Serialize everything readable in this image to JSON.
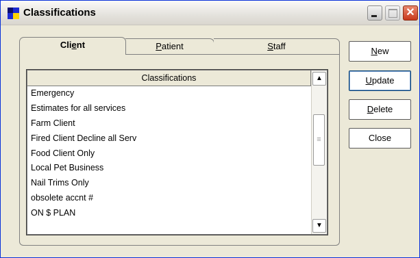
{
  "window": {
    "title": "Classifications"
  },
  "tabs": [
    {
      "label": "Client",
      "mnemonic_index": 3,
      "selected": true
    },
    {
      "label": "Patient",
      "mnemonic_index": 0,
      "selected": false
    },
    {
      "label": "Staff",
      "mnemonic_index": 0,
      "selected": false
    }
  ],
  "list": {
    "header": "Classifications",
    "items": [
      "Emergency",
      "Estimates for all services",
      "Farm Client",
      "Fired Client Decline all Serv",
      "Food Client Only",
      "Local Pet Business",
      "Nail Trims Only",
      "obsolete accnt #",
      "ON $ PLAN"
    ]
  },
  "buttons": {
    "new": {
      "label": "New",
      "mnemonic_index": 0
    },
    "update": {
      "label": "Update",
      "mnemonic_index": 0
    },
    "delete": {
      "label": "Delete",
      "mnemonic_index": 0
    },
    "close": {
      "label": "Close",
      "mnemonic_index": -1
    }
  },
  "icons": {
    "app": "classifications-app-icon",
    "minimize": "minimize-icon",
    "maximize": "maximize-icon",
    "close": "close-icon",
    "scroll_up": "scroll-up-arrow-icon",
    "scroll_down": "scroll-down-arrow-icon",
    "thumb_grip": "scroll-thumb-grip-icon"
  },
  "colors": {
    "window_face": "#ece9d8",
    "close_button": "#c8381a",
    "app_icon_blue": "#1c2bd1",
    "app_icon_yellow": "#ffd400"
  }
}
